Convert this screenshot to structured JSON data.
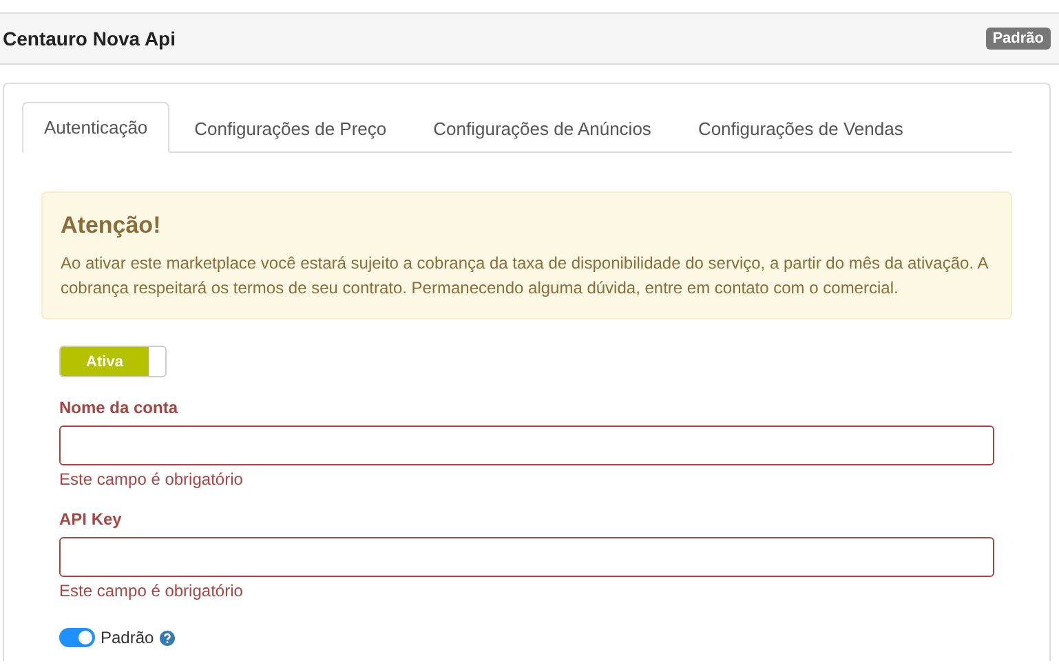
{
  "header": {
    "title": "Centauro Nova Api",
    "badge": "Padrão"
  },
  "tabs": [
    {
      "label": "Autenticação",
      "selected": true
    },
    {
      "label": "Configurações de Preço",
      "selected": false
    },
    {
      "label": "Configurações de Anúncios",
      "selected": false
    },
    {
      "label": "Configurações de Vendas",
      "selected": false
    }
  ],
  "alert": {
    "title": "Atenção!",
    "text": "Ao ativar este marketplace você estará sujeito a cobrança da taxa de disponibilidade do serviço, a partir do mês da ativação. A cobrança respeitará os termos de seu contrato. Permanecendo alguma dúvida, entre em contato com o comercial."
  },
  "status_toggle": {
    "label": "Ativa",
    "on": true
  },
  "fields": [
    {
      "label": "Nome da conta",
      "error": "Este campo é obrigatório",
      "invalid": true
    },
    {
      "label": "API Key",
      "error": "Este campo é obrigatório",
      "invalid": true
    }
  ],
  "default_switch": {
    "label": "Padrão",
    "on": true
  }
}
